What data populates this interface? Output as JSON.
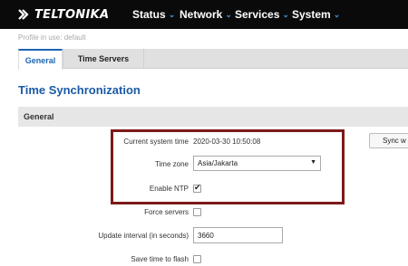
{
  "brand": {
    "name": "TELTONIKA"
  },
  "nav": [
    {
      "label": "Status"
    },
    {
      "label": "Network"
    },
    {
      "label": "Services"
    },
    {
      "label": "System"
    }
  ],
  "profile": {
    "prefix": "Profile in use:",
    "name": "default"
  },
  "tabs": [
    {
      "label": "General",
      "active": true
    },
    {
      "label": "Time Servers",
      "active": false
    }
  ],
  "page_title": "Time Synchronization",
  "section_title": "General",
  "form": {
    "current_time_label": "Current system time",
    "current_time_value": "2020-03-30 10:50:08",
    "sync_button_label": "Sync w",
    "timezone_label": "Time zone",
    "timezone_value": "Asia/Jakarta",
    "enable_ntp_label": "Enable NTP",
    "enable_ntp_checked": true,
    "force_servers_label": "Force servers",
    "force_servers_checked": false,
    "update_interval_label": "Update interval (in seconds)",
    "update_interval_value": "3660",
    "save_time_label": "Save time to flash",
    "save_time_checked": false
  },
  "colors": {
    "accent": "#1a5aa6",
    "highlight_border": "#7d1a1a",
    "topbar": "#0a0a0a",
    "nav_chevron": "#4a90d9"
  }
}
